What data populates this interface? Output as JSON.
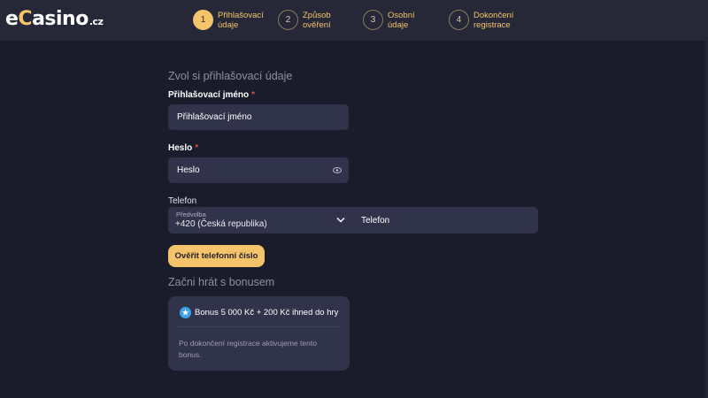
{
  "brand": {
    "logo_e": "e",
    "logo_c": "C",
    "logo_rest": "asino",
    "logo_tld": ".cz",
    "accent_color": "#f5c36a"
  },
  "steps": [
    {
      "number": "1",
      "label": "Přihlašovací údaje",
      "active": true
    },
    {
      "number": "2",
      "label": "Způsob ověření",
      "active": false
    },
    {
      "number": "3",
      "label": "Osobní údaje",
      "active": false
    },
    {
      "number": "4",
      "label": "Dokončení registrace",
      "active": false
    }
  ],
  "login_section": {
    "title": "Zvol si přihlašovací údaje",
    "username": {
      "label": "Přihlašovací jméno",
      "required_mark": "*",
      "placeholder": "Přihlašovací jméno"
    },
    "password": {
      "label": "Heslo",
      "required_mark": "*",
      "placeholder": "Heslo",
      "icon": "eye-icon"
    },
    "phone": {
      "label": "Telefon",
      "prefix_label": "Předvolba",
      "prefix_value": "+420 (Česká republika)",
      "placeholder": "Telefon"
    },
    "verify_button": "Ověřit telefonní číslo"
  },
  "bonus_section": {
    "title": "Začni hrát s bonusem",
    "offer": "Bonus 5 000 Kč + 200 Kč ihned do hry",
    "note": "Po dokončení registrace aktivujeme tento bonus.",
    "icon": "star-icon"
  }
}
